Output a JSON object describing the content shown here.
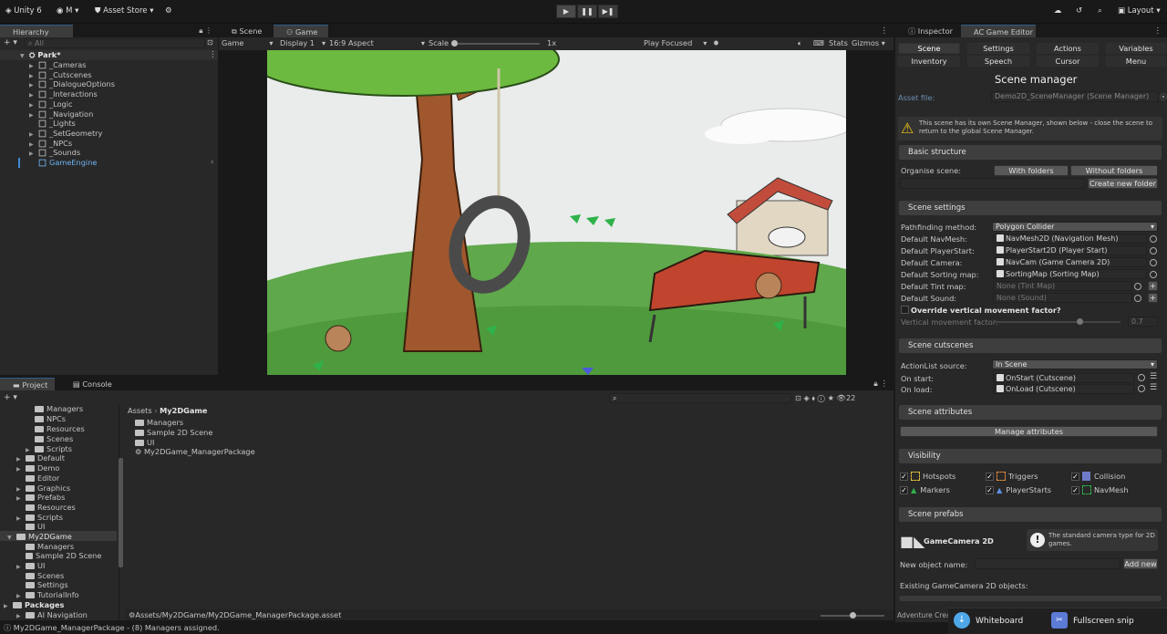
{
  "app": {
    "logo": "Unity 6",
    "account": "M",
    "asset_store": "Asset Store",
    "layout": "Layout"
  },
  "hierarchy": {
    "tab": "Hierarchy",
    "search_placeholder": "All",
    "root": "Park*",
    "items": [
      "_Cameras",
      "_Cutscenes",
      "_DialogueOptions",
      "_Interactions",
      "_Logic",
      "_Navigation",
      "_Lights",
      "_SetGeometry",
      "_NPCs",
      "_Sounds",
      "GameEngine"
    ]
  },
  "viewtabs": {
    "scene": "Scene",
    "game": "Game"
  },
  "gametoolbar": {
    "mode": "Game",
    "display": "Display 1",
    "aspect": "16:9 Aspect",
    "scale_label": "Scale",
    "scale_value": "1x",
    "play_focused": "Play Focused",
    "stats": "Stats",
    "gizmos": "Gizmos"
  },
  "project": {
    "tab": "Project",
    "console_tab": "Console",
    "count": "22",
    "tree": [
      "Managers",
      "NPCs",
      "Resources",
      "Scenes",
      "Scripts",
      "Default",
      "Demo",
      "Editor",
      "Graphics",
      "Prefabs",
      "Resources",
      "Scripts",
      "UI",
      "My2DGame",
      "Managers",
      "Sample 2D Scene",
      "UI",
      "Scenes",
      "Settings",
      "TutorialInfo",
      "Packages",
      "AI Navigation"
    ],
    "breadcrumb_root": "Assets",
    "breadcrumb_current": "My2DGame",
    "contents": [
      "Managers",
      "Sample 2D Scene",
      "UI",
      "My2DGame_ManagerPackage"
    ],
    "path": "Assets/My2DGame/My2DGame_ManagerPackage.asset"
  },
  "status": {
    "message": "My2DGame_ManagerPackage - (8) Managers assigned."
  },
  "inspector": {
    "tab": "Inspector",
    "ac_tab": "AC Game Editor",
    "nav": [
      "Scene",
      "Settings",
      "Actions",
      "Variables",
      "Inventory",
      "Speech",
      "Cursor",
      "Menu"
    ],
    "title": "Scene manager",
    "asset_file_label": "Asset file:",
    "asset_file_value": "Demo2D_SceneManager (Scene Manager)",
    "warning": "This scene has its own Scene Manager, shown below - close the scene to return to the global Scene Manager.",
    "basic_structure": "Basic structure",
    "organise_label": "Organise scene:",
    "with_folders": "With folders",
    "without_folders": "Without folders",
    "create_folder": "Create new folder",
    "scene_settings": "Scene settings",
    "settings": [
      {
        "label": "Pathfinding method:",
        "value": "Polygon Collider"
      },
      {
        "label": "Default NavMesh:",
        "value": "NavMesh2D (Navigation Mesh)"
      },
      {
        "label": "Default PlayerStart:",
        "value": "PlayerStart2D (Player Start)"
      },
      {
        "label": "Default Camera:",
        "value": "NavCam (Game Camera 2D)"
      },
      {
        "label": "Default Sorting map:",
        "value": "SortingMap (Sorting Map)"
      },
      {
        "label": "Default Tint map:",
        "value": "None (Tint Map)"
      },
      {
        "label": "Default Sound:",
        "value": "None (Sound)"
      }
    ],
    "override_label": "Override vertical movement factor?",
    "vertical_label": "Vertical movement factor:",
    "vertical_value": "0.7",
    "scene_cutscenes": "Scene cutscenes",
    "actionlist_label": "ActionList source:",
    "actionlist_value": "In Scene",
    "on_start_label": "On start:",
    "on_start_value": "OnStart (Cutscene)",
    "on_load_label": "On load:",
    "on_load_value": "OnLoad (Cutscene)",
    "scene_attributes": "Scene attributes",
    "manage_attributes": "Manage attributes",
    "visibility": "Visibility",
    "vis_items": [
      "Hotspots",
      "Triggers",
      "Collision",
      "Markers",
      "PlayerStarts",
      "NavMesh"
    ],
    "scene_prefabs": "Scene prefabs",
    "prefab_name": "GameCamera 2D",
    "prefab_desc": "The standard camera type for 2D games.",
    "new_object_label": "New object name:",
    "add_new": "Add new",
    "existing_label": "Existing GameCamera 2D objects:",
    "footer": "Adventure Creato"
  },
  "taskbar": {
    "whiteboard": "Whiteboard",
    "snip": "Fullscreen snip"
  }
}
